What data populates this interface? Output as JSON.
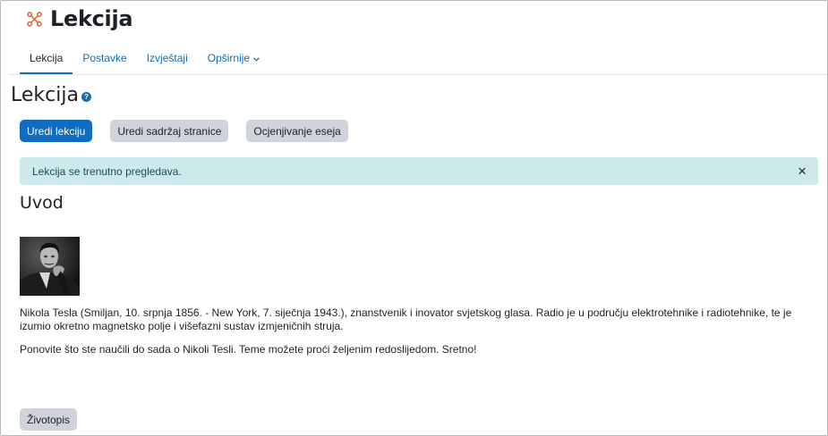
{
  "header": {
    "module_icon": "lesson-nodes-icon",
    "title": "Lekcija",
    "accent_color": "#e05d2e"
  },
  "secondary_nav": {
    "tabs": [
      {
        "label": "Lekcija",
        "active": true
      },
      {
        "label": "Postavke",
        "active": false
      },
      {
        "label": "Izvještaji",
        "active": false
      },
      {
        "label": "Opširnije",
        "active": false,
        "has_dropdown": true,
        "caret_icon": "chevron-down-icon"
      }
    ]
  },
  "activity": {
    "title": "Lekcija",
    "help_icon": "question-circle-icon",
    "help_glyph": "?"
  },
  "actions": {
    "edit_lesson": "Uredi lekciju",
    "edit_page_content": "Uredi sadržaj stranice",
    "grade_essays": "Ocjenjivanje eseja"
  },
  "alert": {
    "message": "Lekcija se trenutno pregledava.",
    "close_glyph": "×",
    "background": "#cde9ec"
  },
  "content": {
    "heading": "Uvod",
    "image_icon": "portrait-photo",
    "paragraphs": [
      "Nikola Tesla (Smiljan, 10. srpnja 1856. - New York, 7. siječnja 1943.), znanstvenik i inovator svjetskog glasa. Radio je u području elektrotehnike i radiotehnike, te je izumio okretno magnetsko polje i višefazni sustav izmjeničnih struja.",
      "Ponovite što ste naučili do sada o Nikoli Tesli. Teme možete proći željenim redoslijedom. Sretno!"
    ],
    "branch_button": "Životopis"
  },
  "colors": {
    "primary": "#0f6cbf",
    "secondary_button": "#ced4da",
    "text": "#1d2125"
  }
}
